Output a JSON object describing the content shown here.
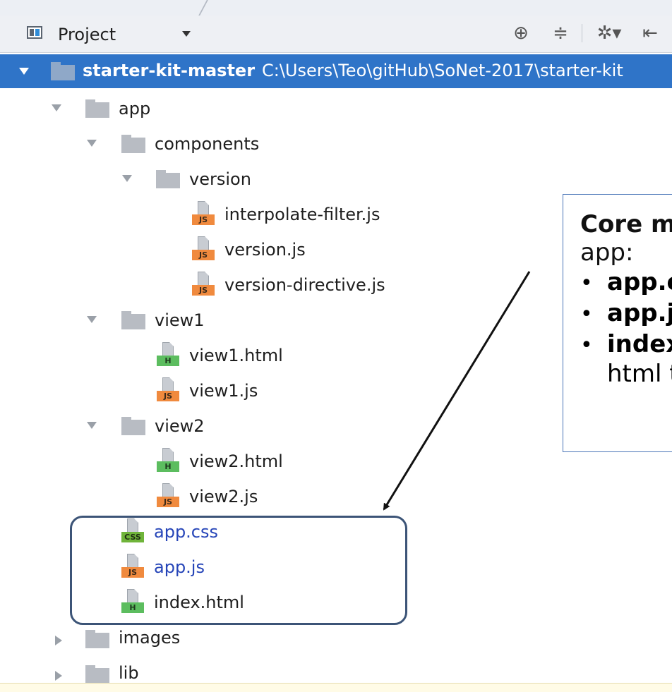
{
  "toolbar": {
    "panel_label": "Project",
    "icons": [
      "target-icon",
      "collapse-icon",
      "gear-icon",
      "hide-icon"
    ]
  },
  "tree": {
    "root_name": "starter-kit-master",
    "root_path": "C:\\Users\\Teo\\gitHub\\SoNet-2017\\starter-kit",
    "app": "app",
    "components": "components",
    "version_folder": "version",
    "interpolate_filter": "interpolate-filter.js",
    "version_js": "version.js",
    "version_directive": "version-directive.js",
    "view1": "view1",
    "view1_html": "view1.html",
    "view1_js": "view1.js",
    "view2": "view2",
    "view2_html": "view2.html",
    "view2_js": "view2.js",
    "app_css": "app.css",
    "app_js": "app.js",
    "index_html": "index.html",
    "images": "images",
    "lib": "lib"
  },
  "badges": {
    "js": "JS",
    "html": "H",
    "css": "CSS"
  },
  "callout": {
    "title": "Core mo",
    "subtitle": "app:",
    "item1": "app.cs",
    "item2": "app.js",
    "item3": "index",
    "item3_cont": "html t"
  },
  "colors": {
    "selection": "#2f74c8",
    "js_badge": "#f08a3e",
    "html_badge": "#5cbd5f",
    "css_badge": "#6fb43a",
    "highlight_border": "#3c5477",
    "callout_border": "#4a75b8",
    "modified_file_text": "#2645b8"
  }
}
